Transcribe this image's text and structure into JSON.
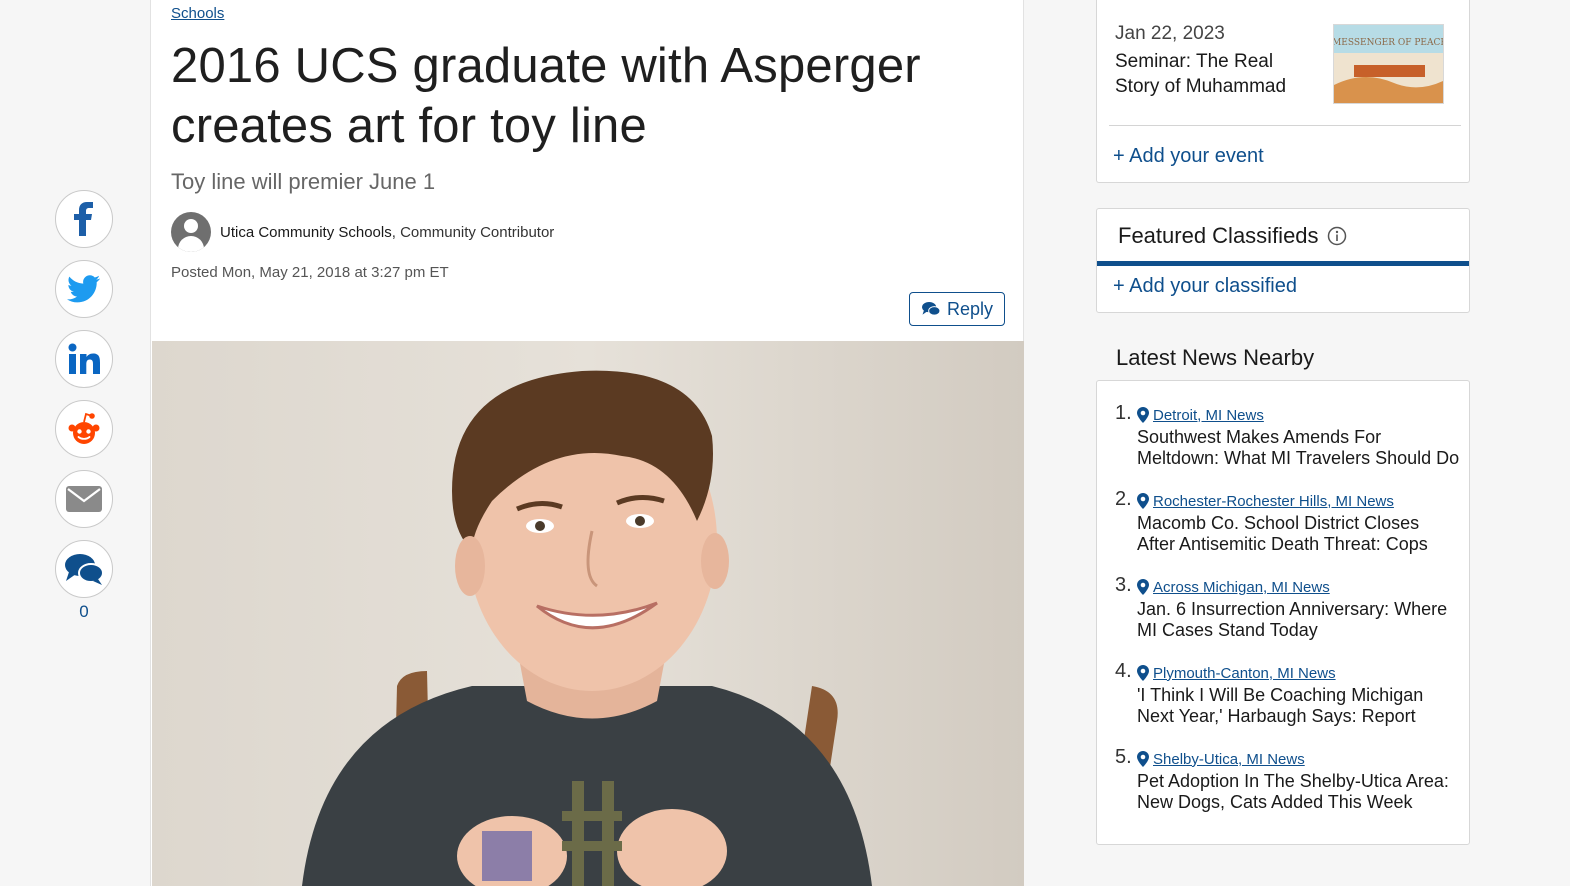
{
  "share": {
    "buttons": [
      {
        "name": "facebook",
        "icon": "facebook-icon",
        "color": "#1d5fa8"
      },
      {
        "name": "twitter",
        "icon": "twitter-icon",
        "color": "#1d9bf0"
      },
      {
        "name": "linkedin",
        "icon": "linkedin-icon",
        "color": "#0a66c2"
      },
      {
        "name": "reddit",
        "icon": "reddit-icon",
        "color": "#ff4500"
      },
      {
        "name": "email",
        "icon": "email-icon",
        "color": "#8a8a8a"
      },
      {
        "name": "comments",
        "icon": "comments-icon",
        "color": "#0f4f8c"
      }
    ],
    "comment_count": "0"
  },
  "article": {
    "breadcrumb": "Schools",
    "headline": "2016 UCS graduate with Asperger creates art for toy line",
    "subhead": "Toy line will premier June 1",
    "author_name": "Utica Community Schools",
    "author_role": ", Community Contributor",
    "posted": "Posted Mon, May 21, 2018 at 3:27 pm ET",
    "reply_label": "Reply"
  },
  "events": {
    "date": "Jan 22, 2023",
    "title": "Seminar: The Real Story of Muhammad",
    "thumb_title": "MESSENGER OF PEACE",
    "add_label": "+ Add your event"
  },
  "classifieds": {
    "title": "Featured Classifieds",
    "add_label": "+ Add your classified"
  },
  "latest_news": {
    "heading": "Latest News Nearby",
    "items": [
      {
        "num": "1.",
        "location": "Detroit, MI News",
        "title": "Southwest Makes Amends For Meltdown: What MI Travelers Should Do"
      },
      {
        "num": "2.",
        "location": "Rochester-Rochester Hills, MI News",
        "title": "Macomb Co. School District Closes After Antisemitic Death Threat: Cops"
      },
      {
        "num": "3.",
        "location": "Across Michigan, MI News",
        "title": "Jan. 6 Insurrection Anniversary: Where MI Cases Stand Today"
      },
      {
        "num": "4.",
        "location": "Plymouth-Canton, MI News",
        "title": "'I Think I Will Be Coaching Michigan Next Year,' Harbaugh Says: Report"
      },
      {
        "num": "5.",
        "location": "Shelby-Utica, MI News",
        "title": "Pet Adoption In The Shelby-Utica Area: New Dogs, Cats Added This Week"
      }
    ]
  },
  "colors": {
    "accent": "#0f4f8c",
    "background": "#f6f6f6"
  }
}
